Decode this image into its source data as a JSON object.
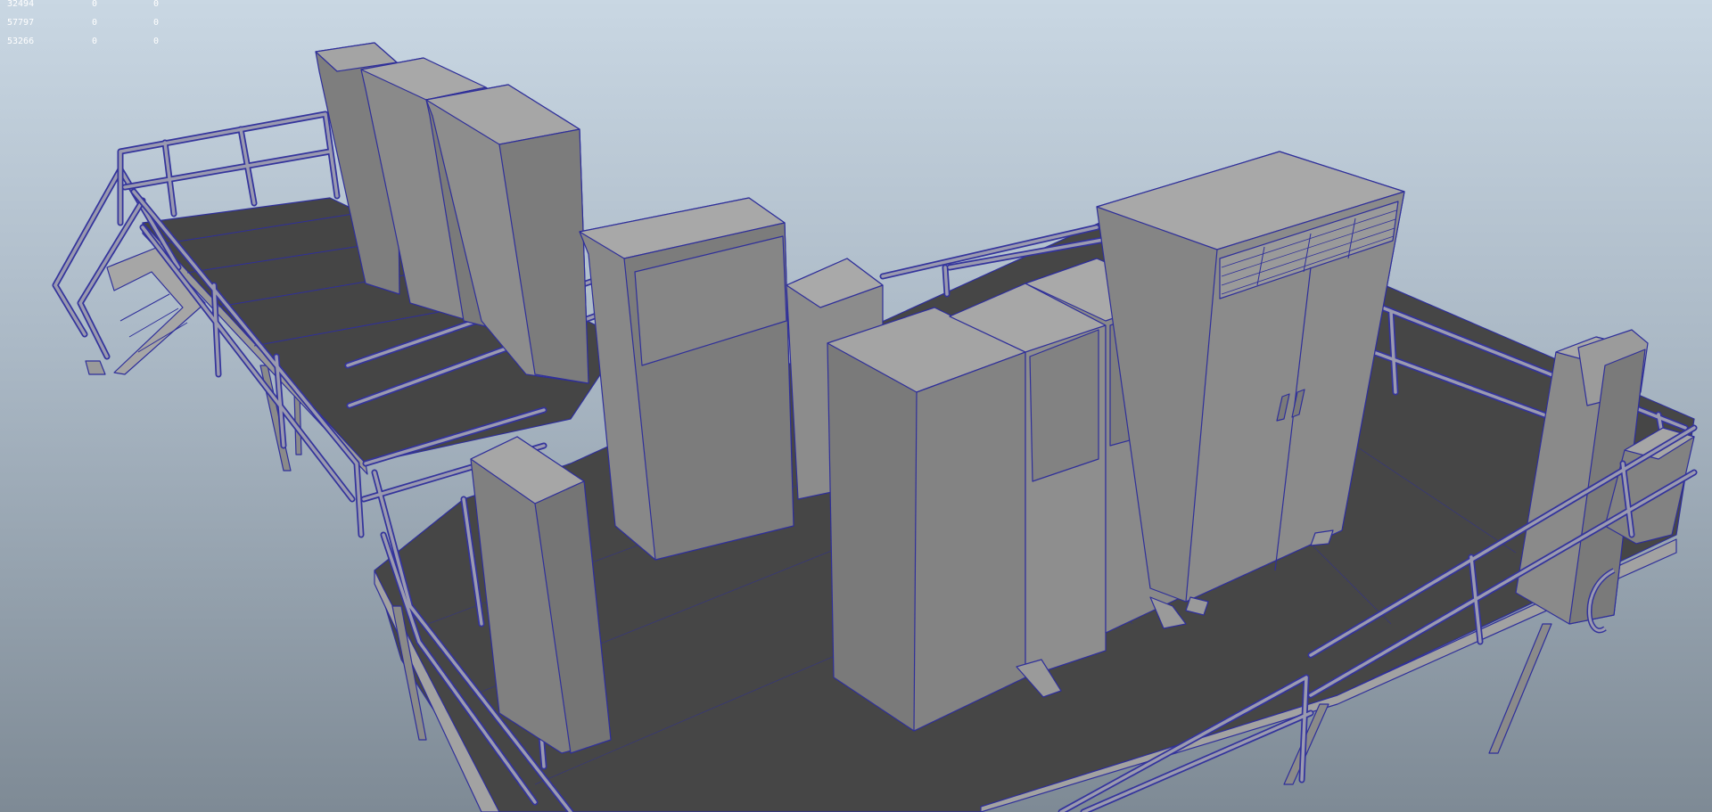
{
  "hud": {
    "rows": [
      {
        "c0": "32494",
        "c1": "0",
        "c2": "0"
      },
      {
        "c0": "57797",
        "c1": "0",
        "c2": "0"
      },
      {
        "c0": "53266",
        "c1": "0",
        "c2": "0"
      }
    ]
  },
  "scene": {
    "description_icon": "3d-viewport-wireframe-on-shaded",
    "colors": {
      "background_top": "#c9d7e3",
      "background_bottom": "#7e8a95",
      "floor": "#464646",
      "cabinet": "#8e8e8e",
      "wireframe": "#2f2f9a"
    }
  }
}
